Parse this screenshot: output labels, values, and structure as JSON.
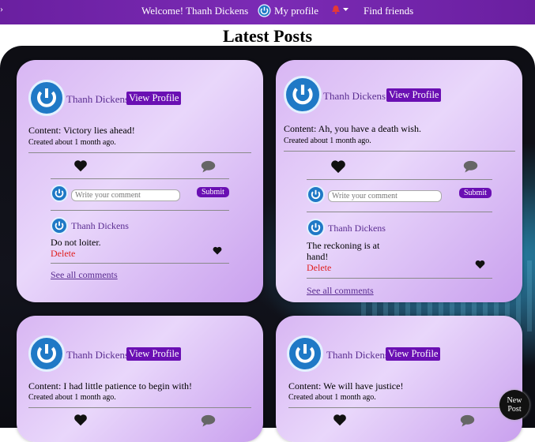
{
  "nav": {
    "welcome": "Welcome! Thanh Dickens",
    "my_profile": "My profile",
    "find_friends": "Find friends"
  },
  "page_title": "Latest Posts",
  "posts": [
    {
      "author": "Thanh Dickens",
      "profile_label": "View Profile",
      "content": "Content: Victory lies ahead!",
      "created": "Created about 1 month ago.",
      "comment_placeholder": "Write your comment",
      "submit_label": "Submit",
      "comment": {
        "author": "Thanh Dickens",
        "text": "Do not loiter.",
        "delete_label": "Delete"
      },
      "see_all": "See all comments"
    },
    {
      "author": "Thanh Dickens",
      "profile_label": "View Profile",
      "content": "Content: Ah, you have a death wish.",
      "created": "Created about 1 month ago.",
      "comment_placeholder": "Write your comment",
      "submit_label": "Submit",
      "comment": {
        "author": "Thanh Dickens",
        "text": "The reckoning is at hand!",
        "delete_label": "Delete"
      },
      "see_all": "See all comments"
    },
    {
      "author": "Thanh Dickens",
      "profile_label": "View Profile",
      "content": "Content: I had little patience to begin with!",
      "created": "Created about 1 month ago."
    },
    {
      "author": "Thanh Dickens",
      "profile_label": "View Profile",
      "content": "Content: We will have justice!",
      "created": "Created about 1 month ago."
    }
  ],
  "new_post": {
    "line1": "New",
    "line2": "Post"
  },
  "colors": {
    "nav": "#6a1fa0",
    "accent": "#6a0fb3",
    "delete": "#e02020",
    "bell": "#e53935"
  }
}
